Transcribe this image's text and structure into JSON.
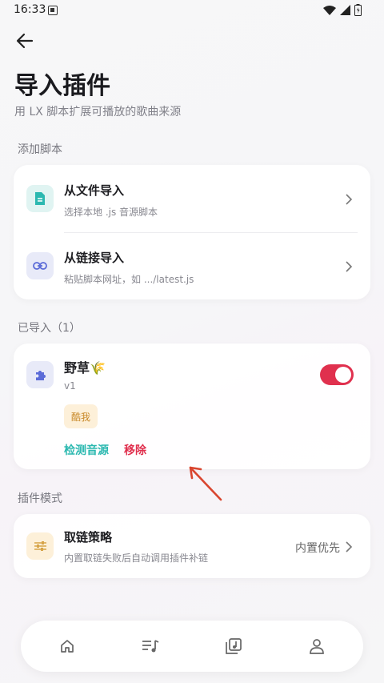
{
  "status_bar": {
    "time": "16:33"
  },
  "header": {
    "title": "导入插件",
    "subtitle": "用 LX 脚本扩展可播放的歌曲来源"
  },
  "add_script": {
    "section_label": "添加脚本",
    "items": [
      {
        "title": "从文件导入",
        "desc": "选择本地 .js 音源脚本",
        "icon": "file-icon",
        "icon_color": "#2bb8b0"
      },
      {
        "title": "从链接导入",
        "desc": "粘贴脚本网址，如 .../latest.js",
        "icon": "link-icon",
        "icon_color": "#5b6bd8"
      }
    ]
  },
  "imported": {
    "section_label": "已导入（1）",
    "plugin": {
      "name": "野草🌾",
      "version": "v1",
      "tag": "酷我",
      "enabled": true,
      "check_label": "检测音源",
      "remove_label": "移除",
      "accent_check": "#2bb8b0",
      "accent_remove": "#e0304e"
    }
  },
  "plugin_mode": {
    "section_label": "插件模式",
    "strategy": {
      "title": "取链策略",
      "desc": "内置取链失败后自动调用插件补链",
      "value": "内置优先"
    }
  },
  "bottom_nav": {
    "items": [
      "home-icon",
      "playlist-icon",
      "library-icon",
      "profile-icon"
    ]
  }
}
